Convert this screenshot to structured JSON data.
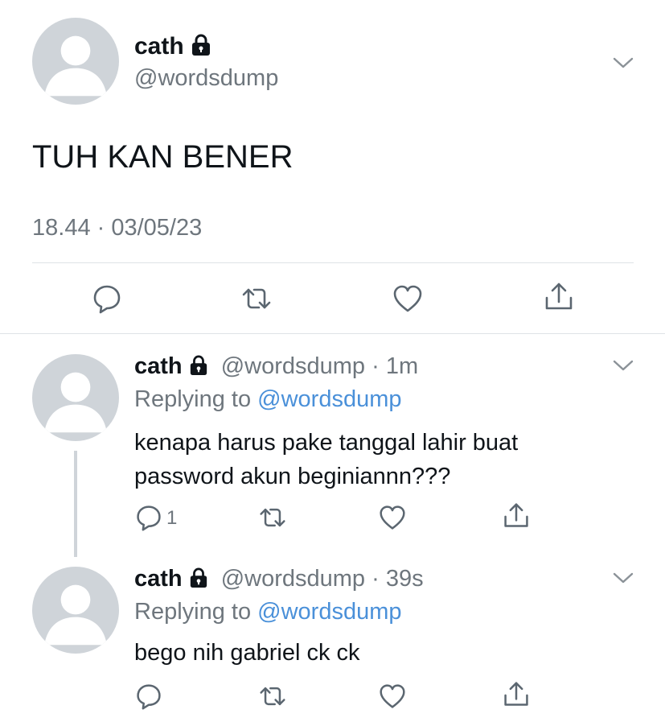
{
  "main_tweet": {
    "display_name": "cath",
    "handle": "@wordsdump",
    "text": "TUH KAN BENER",
    "timestamp": "18.44 · 03/05/23",
    "actions": [
      "reply-icon",
      "retweet-icon",
      "like-icon",
      "share-icon"
    ]
  },
  "replies": [
    {
      "display_name": "cath",
      "handle": "@wordsdump",
      "time": "· 1m",
      "replying_prefix": "Replying to",
      "replying_to": "@wordsdump",
      "text_line1": "kenapa harus pake tanggal lahir buat",
      "text_line2": "password akun beginiannn???",
      "reply_count": "1"
    },
    {
      "display_name": "cath",
      "handle": "@wordsdump",
      "time": "· 39s",
      "replying_prefix": "Replying to",
      "replying_to": "@wordsdump",
      "text_line1": "bego nih gabriel ck ck",
      "reply_count": ""
    }
  ],
  "colors": {
    "text": "#0f1419",
    "muted": "#6e767d",
    "link": "#4a90d9",
    "avatar_bg": "#cfd4d9",
    "divider": "#dfe3e6"
  }
}
